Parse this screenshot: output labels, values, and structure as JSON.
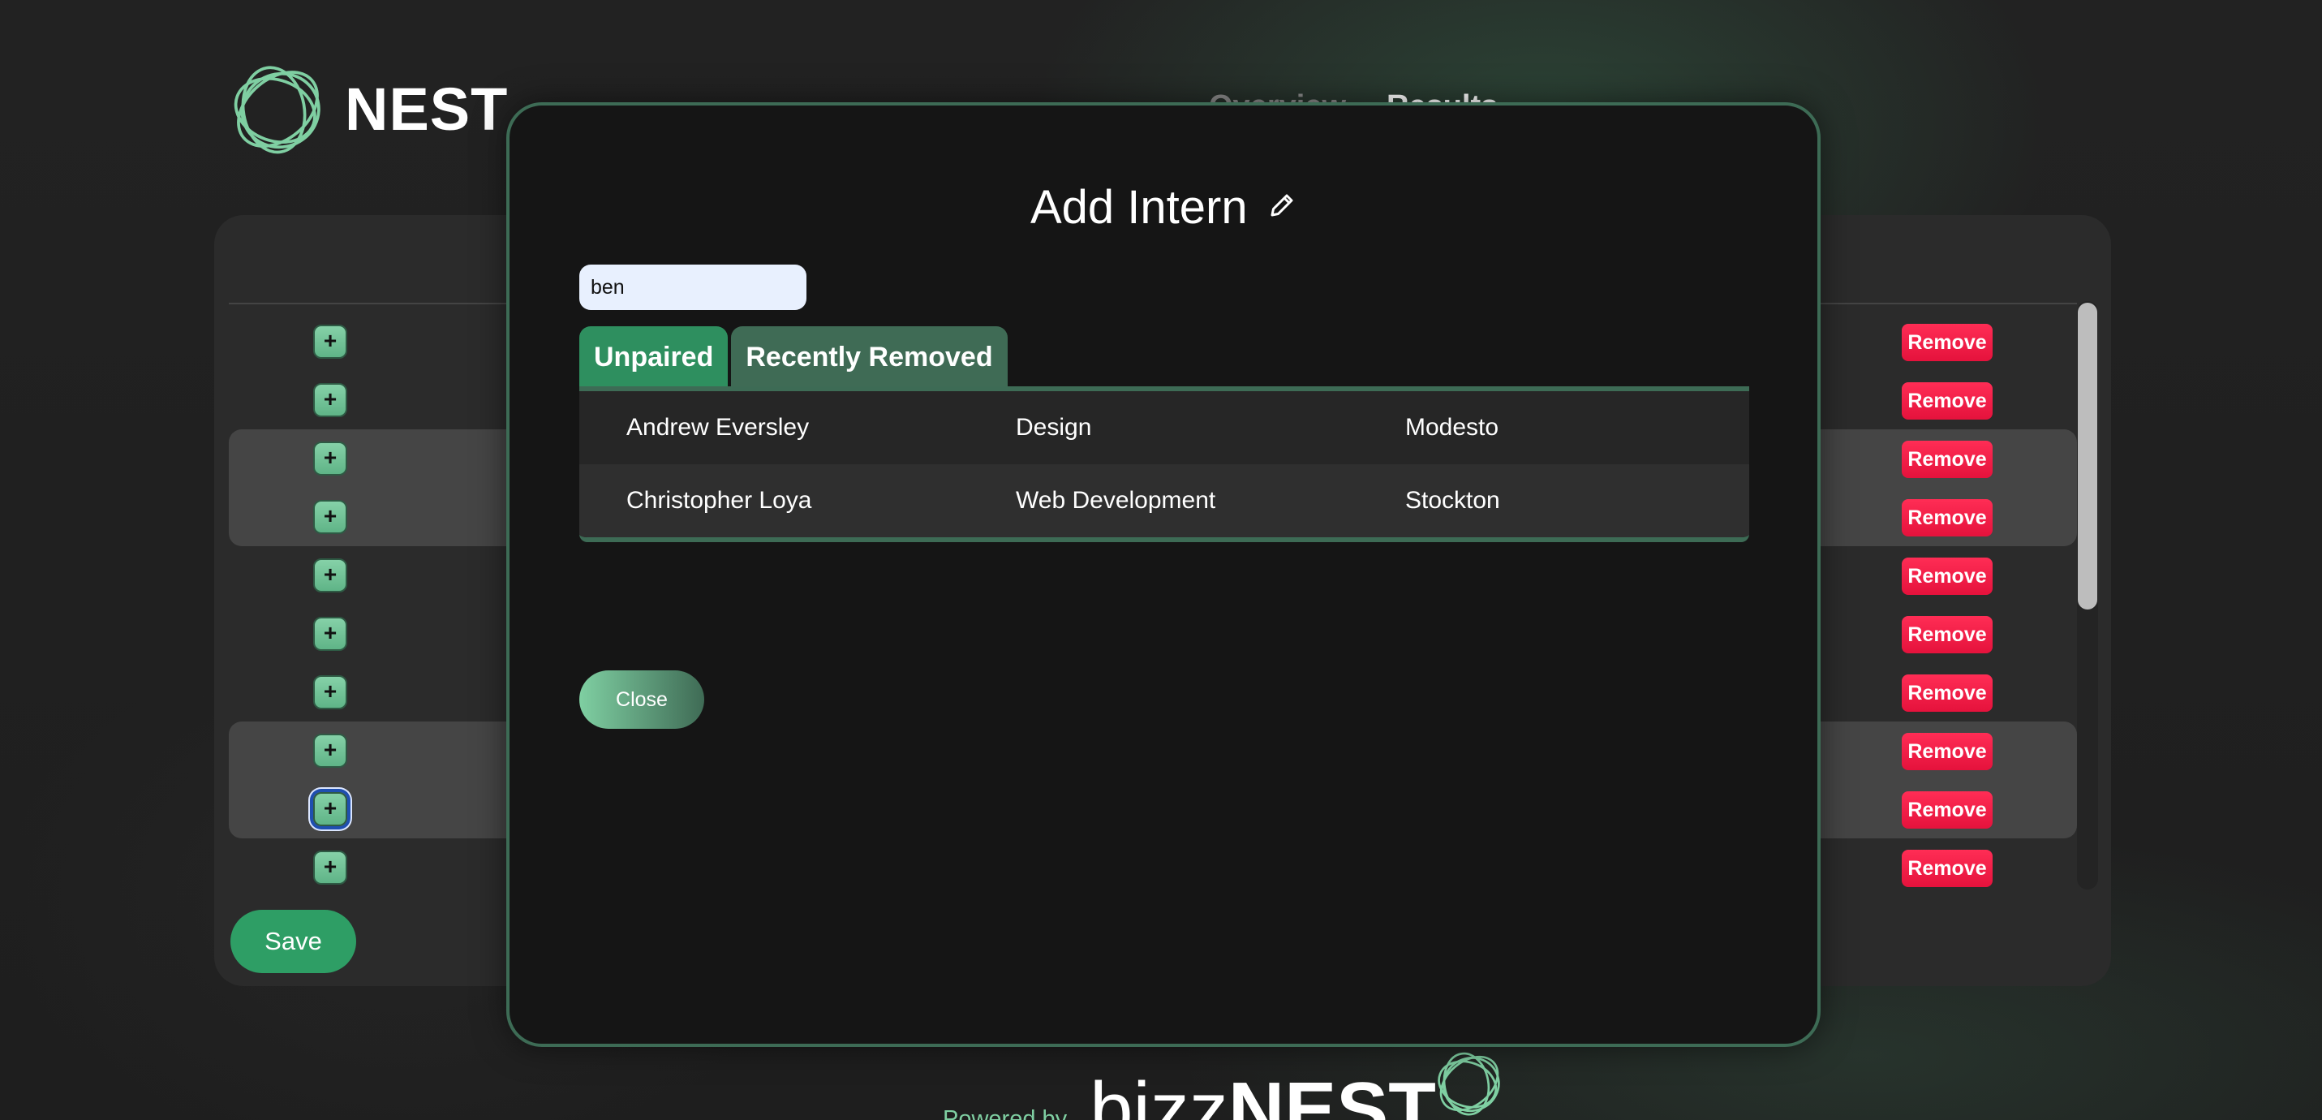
{
  "header": {
    "brand_name": "NEST",
    "nav": [
      "Overview",
      "Results"
    ]
  },
  "panel": {
    "row_count": 10,
    "add_button_label": "+",
    "remove_button_label": "Remove",
    "save_label": "Save"
  },
  "modal": {
    "title": "Add Intern",
    "search": {
      "value": "ben",
      "placeholder": ""
    },
    "tabs": [
      {
        "label": "Unpaired",
        "active": true
      },
      {
        "label": "Recently Removed",
        "active": false
      }
    ],
    "rows": [
      {
        "name": "Andrew Eversley",
        "track": "Design",
        "city": "Modesto"
      },
      {
        "name": "Christopher Loya",
        "track": "Web Development",
        "city": "Stockton"
      }
    ],
    "close_label": "Close"
  },
  "footer": {
    "powered_by": "Powered by",
    "wordmark_light": "bizz",
    "wordmark_bold": "NEST"
  },
  "colors": {
    "accent": "#2e9e65",
    "remove": "#ff2d55",
    "modal_border": "#3d6b55"
  }
}
